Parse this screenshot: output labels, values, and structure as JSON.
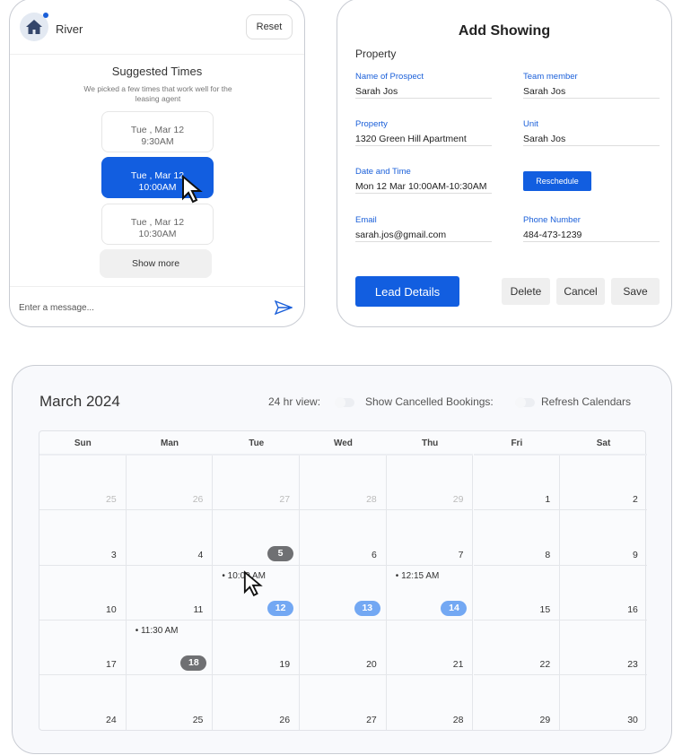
{
  "chat": {
    "name": "River",
    "reset": "Reset",
    "title": "Suggested Times",
    "subtitle": "We picked a few times that work well for the leasing agent",
    "slots": [
      {
        "date": "Tue , Mar 12",
        "time": "9:30AM"
      },
      {
        "date": "Tue , Mar 12",
        "time": "10:00AM",
        "selected": true
      },
      {
        "date": "Tue , Mar 12",
        "time": "10:30AM"
      }
    ],
    "show_more": "Show more",
    "placeholder": "Enter a message..."
  },
  "showing": {
    "title": "Add Showing",
    "section": "Property",
    "fields": [
      {
        "label": "Name of Prospect",
        "value": "Sarah Jos"
      },
      {
        "label": "Team member",
        "value": "Sarah Jos"
      },
      {
        "label": "Property",
        "value": "1320 Green Hill Apartment"
      },
      {
        "label": "Unit",
        "value": "Sarah Jos"
      },
      {
        "label": "Date and Time",
        "value": "Mon 12 Mar 10:00AM-10:30AM"
      },
      {
        "label": "Email",
        "value": "sarah.jos@gmail.com"
      },
      {
        "label": "Phone Number",
        "value": "484-473-1239"
      }
    ],
    "reschedule": "Reschedule",
    "lead_details": "Lead Details",
    "delete": "Delete",
    "cancel": "Cancel",
    "save": "Save"
  },
  "calendar": {
    "month": "March 2024",
    "opt_24hr": "24 hr view:",
    "opt_cancelled": "Show Cancelled Bookings:",
    "opt_refresh": "Refresh Calendars",
    "days": [
      "Sun",
      "Man",
      "Tue",
      "Wed",
      "Thu",
      "Fri",
      "Sat"
    ],
    "weeks": [
      [
        "25",
        "26",
        "27",
        "28",
        "29",
        "1",
        "2"
      ],
      [
        "3",
        "4",
        "5",
        "6",
        "7",
        "8",
        "9"
      ],
      [
        "10",
        "11",
        "12",
        "13",
        "14",
        "15",
        "16"
      ],
      [
        "17",
        "18",
        "19",
        "20",
        "21",
        "22",
        "23"
      ],
      [
        "24",
        "25",
        "26",
        "27",
        "28",
        "29",
        "30"
      ]
    ],
    "events": {
      "12": "10:00 AM",
      "14": "12:15 AM",
      "18": "11:30 AM"
    },
    "badges": {
      "5": "gray",
      "12": "blue",
      "13": "blue",
      "14": "blue",
      "18": "gray"
    },
    "colors": {
      "accent": "#125ee0",
      "badge_blue": "#73a8f3",
      "badge_gray": "#6f7073"
    }
  }
}
